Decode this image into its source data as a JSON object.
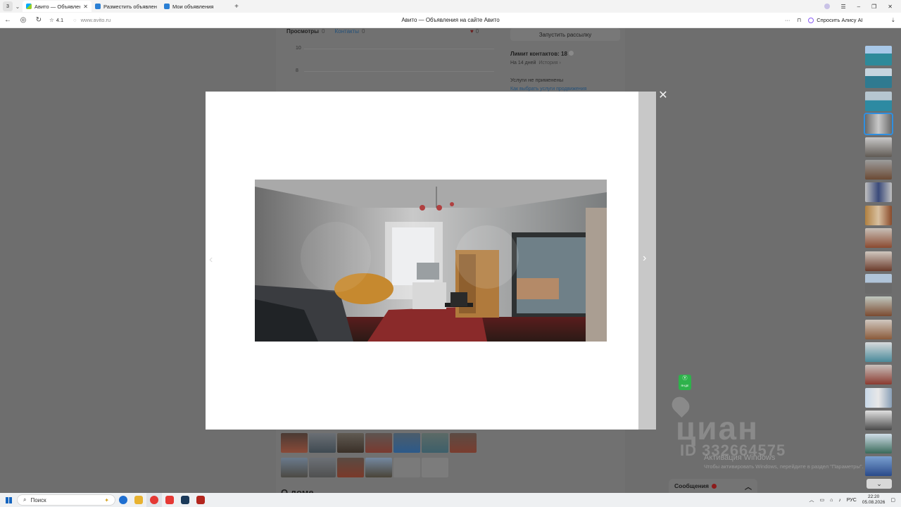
{
  "browser": {
    "tab_count": "3",
    "tabs": [
      {
        "label": "Авито — Объявления н",
        "active": true
      },
      {
        "label": "Разместить объявление",
        "active": false
      },
      {
        "label": "Мои объявления",
        "active": false
      }
    ],
    "rating": "4.1",
    "url": "www.avito.ru",
    "page_title": "Авито — Объявления на сайте Авито",
    "alice_label": "Спросить Алису AI"
  },
  "stats": {
    "views_label": "Просмотры",
    "views_count": "0",
    "contacts_label": "Контакты",
    "contacts_count": "0",
    "favorites_count": "0",
    "y_axis": [
      "10",
      "8"
    ]
  },
  "right_panel": {
    "mailing_button": "Запустить рассылку",
    "contact_limit": "Лимит контактов: 18",
    "period": "На 14 дней",
    "history_link": "История ›",
    "services_none": "Услуги не применены",
    "services_how": "Как выбрать услуги продвижения"
  },
  "section_heading": "О доме",
  "watermark": {
    "brand": "циан",
    "id": "ID 332664575"
  },
  "windows_activation": {
    "title": "Активация Windows",
    "subtitle": "Чтобы активировать Windows, перейдите в раздел \"Параметры\"."
  },
  "messages_label": "Сообщения",
  "badge_label": "ЯНДЕ",
  "taskbar": {
    "search_placeholder": "Поиск",
    "lang": "РУС",
    "time": "22:20",
    "date": "05.08.2026"
  },
  "gallery": {
    "selected_index": 3,
    "thumb_count": 19
  },
  "colors": {
    "accent": "#2f8fe0",
    "overlay": "#6e6e6e"
  }
}
